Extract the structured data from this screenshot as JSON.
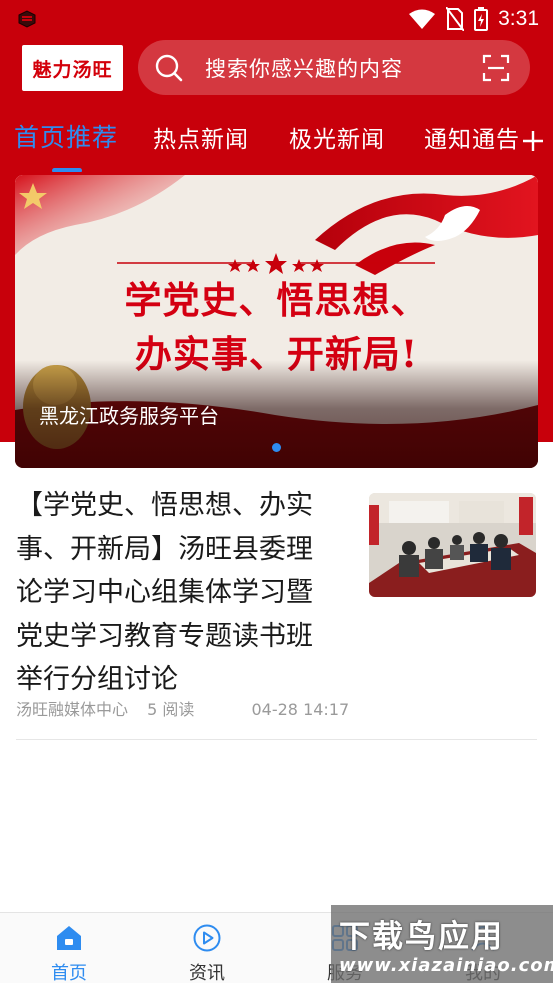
{
  "status_bar": {
    "time": "3:31"
  },
  "header": {
    "logo_text": "魅力汤旺",
    "search_placeholder": "搜索你感兴趣的内容"
  },
  "tabs": [
    {
      "label": "首页推荐",
      "active": true
    },
    {
      "label": "热点新闻",
      "active": false
    },
    {
      "label": "极光新闻",
      "active": false
    },
    {
      "label": "通知通告",
      "active": false
    }
  ],
  "banner": {
    "headline_line1": "学党史、悟思想、",
    "headline_line2": "办实事、开新局!",
    "caption": "黑龙江政务服务平台",
    "slide_count": 1,
    "current_slide": 1
  },
  "articles": [
    {
      "title": "【学党史、悟思想、办实事、开新局】汤旺县委理论学习中心组集体学习暨党史学习教育专题读书班举行分组讨论",
      "source": "汤旺融媒体中心",
      "reads": "5 阅读",
      "date": "04-28 14:17"
    }
  ],
  "bottom_nav": [
    {
      "label": "首页",
      "icon": "home-icon",
      "active": true
    },
    {
      "label": "资讯",
      "icon": "play-circle-icon",
      "active": false
    },
    {
      "label": "服务",
      "icon": "grid-icon",
      "active": false
    },
    {
      "label": "我的",
      "icon": "user-icon",
      "active": false
    }
  ],
  "watermark": {
    "main": "下载鸟应用",
    "url": "www.xiazainiao.com"
  },
  "colors": {
    "brand_red": "#c8000b",
    "accent_blue": "#2e8cf0",
    "text_dark": "#1a1a1a",
    "text_meta": "#9a9a9a"
  }
}
